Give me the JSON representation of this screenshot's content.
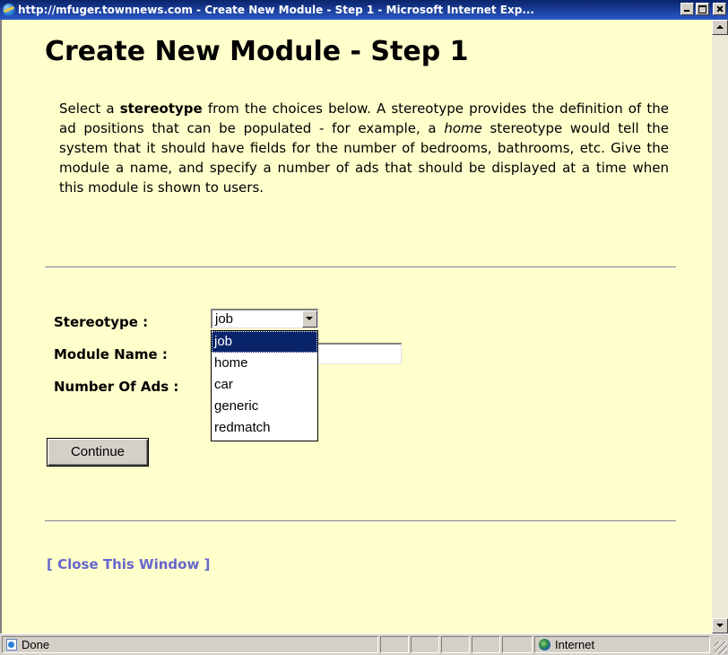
{
  "window": {
    "title": "http://mfuger.townnews.com - Create New Module - Step 1 - Microsoft Internet Exp..."
  },
  "page": {
    "heading": "Create New Module - Step 1",
    "intro": {
      "p1": "Select a ",
      "b1": "stereotype",
      "p2": " from the choices below. A stereotype provides the definition of the ad positions that can be populated - for example, a ",
      "i1": "home",
      "p3": " stereotype would tell the system that it should have fields for the number of bedrooms, bathrooms, etc. Give the module a name, and specify a number of ads that should be displayed at a time when this module is shown to users."
    },
    "form": {
      "stereotype_label": "Stereotype :",
      "stereotype_value": "job",
      "stereotype_options": [
        "job",
        "home",
        "car",
        "generic",
        "redmatch"
      ],
      "module_name_label": "Module Name :",
      "module_name_value": "",
      "number_of_ads_label": "Number Of Ads :",
      "continue_label": "Continue"
    },
    "close_link": "[ Close This Window ]"
  },
  "statusbar": {
    "status_text": "Done",
    "zone_text": "Internet"
  }
}
